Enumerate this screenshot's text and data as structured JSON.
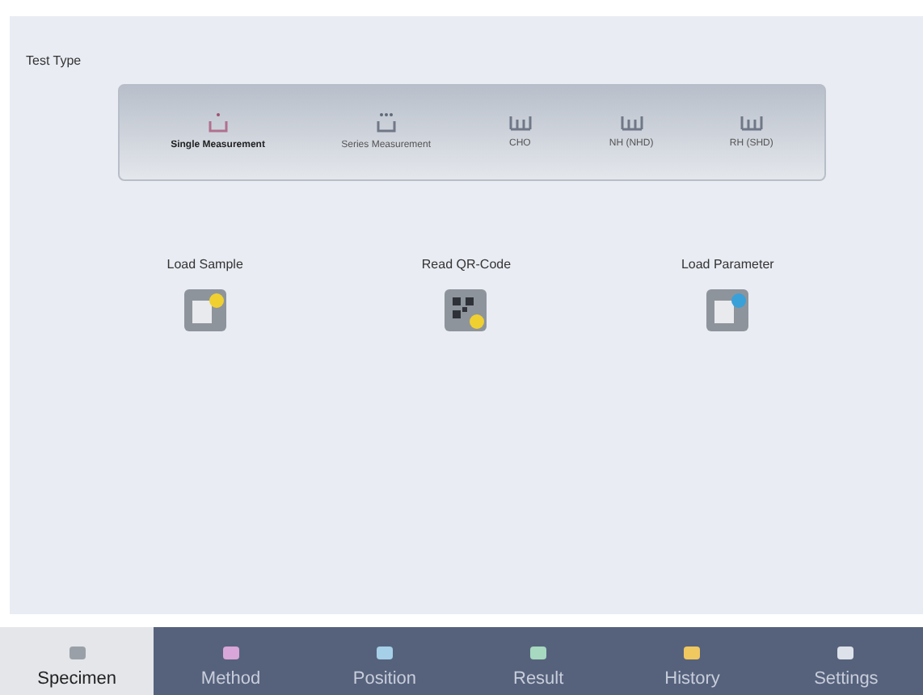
{
  "section_title": "Test Type",
  "test_types": [
    {
      "label": "Single Measurement",
      "kind": "single",
      "selected": true
    },
    {
      "label": "Series Measurement",
      "kind": "series",
      "selected": false
    },
    {
      "label": "CHO",
      "kind": "sensor",
      "selected": false
    },
    {
      "label": "NH (NHD)",
      "kind": "sensor",
      "selected": false
    },
    {
      "label": "RH (SHD)",
      "kind": "sensor",
      "selected": false
    }
  ],
  "actions": [
    {
      "label": "Load Sample",
      "kind": "load"
    },
    {
      "label": "Read QR-Code",
      "kind": "qr"
    },
    {
      "label": "Load Parameter",
      "kind": "param"
    }
  ],
  "tabs": [
    {
      "label": "Specimen",
      "selected": true,
      "color": "#9aa0a8"
    },
    {
      "label": "Method",
      "selected": false,
      "color": "#d9a6d9"
    },
    {
      "label": "Position",
      "selected": false,
      "color": "#a6d0e8"
    },
    {
      "label": "Result",
      "selected": false,
      "color": "#a6d9c0"
    },
    {
      "label": "History",
      "selected": false,
      "color": "#f0c860"
    },
    {
      "label": "Settings",
      "selected": false,
      "color": "#dde2ea"
    }
  ]
}
